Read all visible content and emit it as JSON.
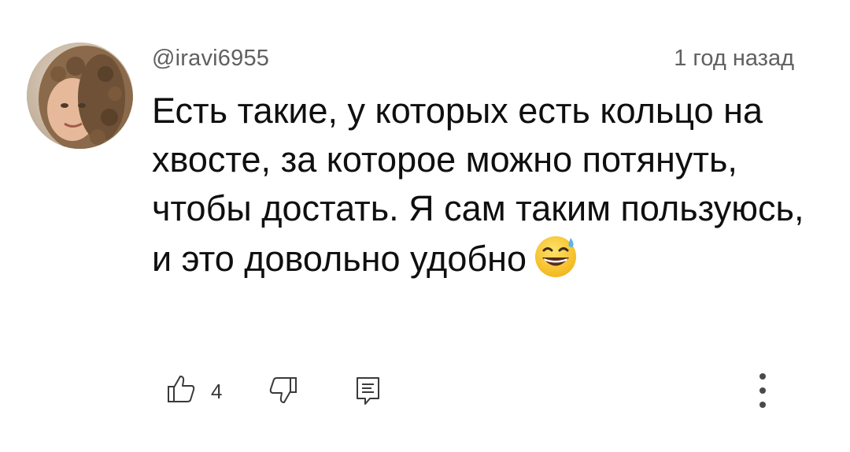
{
  "comment": {
    "username": "@iravi6955",
    "timestamp": "1 год назад",
    "text": "Есть такие, у которых есть кольцо на хвосте, за которое можно потянуть, чтобы достать. Я сам таким пользуюсь, и это довольно удобно",
    "emoji": "grinning-face-with-sweat",
    "like_count": "4"
  },
  "icons": {
    "like": "thumbs-up-icon",
    "dislike": "thumbs-down-icon",
    "reply": "reply-comment-icon",
    "more": "more-vertical-icon"
  },
  "colors": {
    "text": "#0f0f0f",
    "secondary_text": "#606060",
    "icon": "#3a3a3a",
    "emoji_face": "#f7c21b"
  }
}
